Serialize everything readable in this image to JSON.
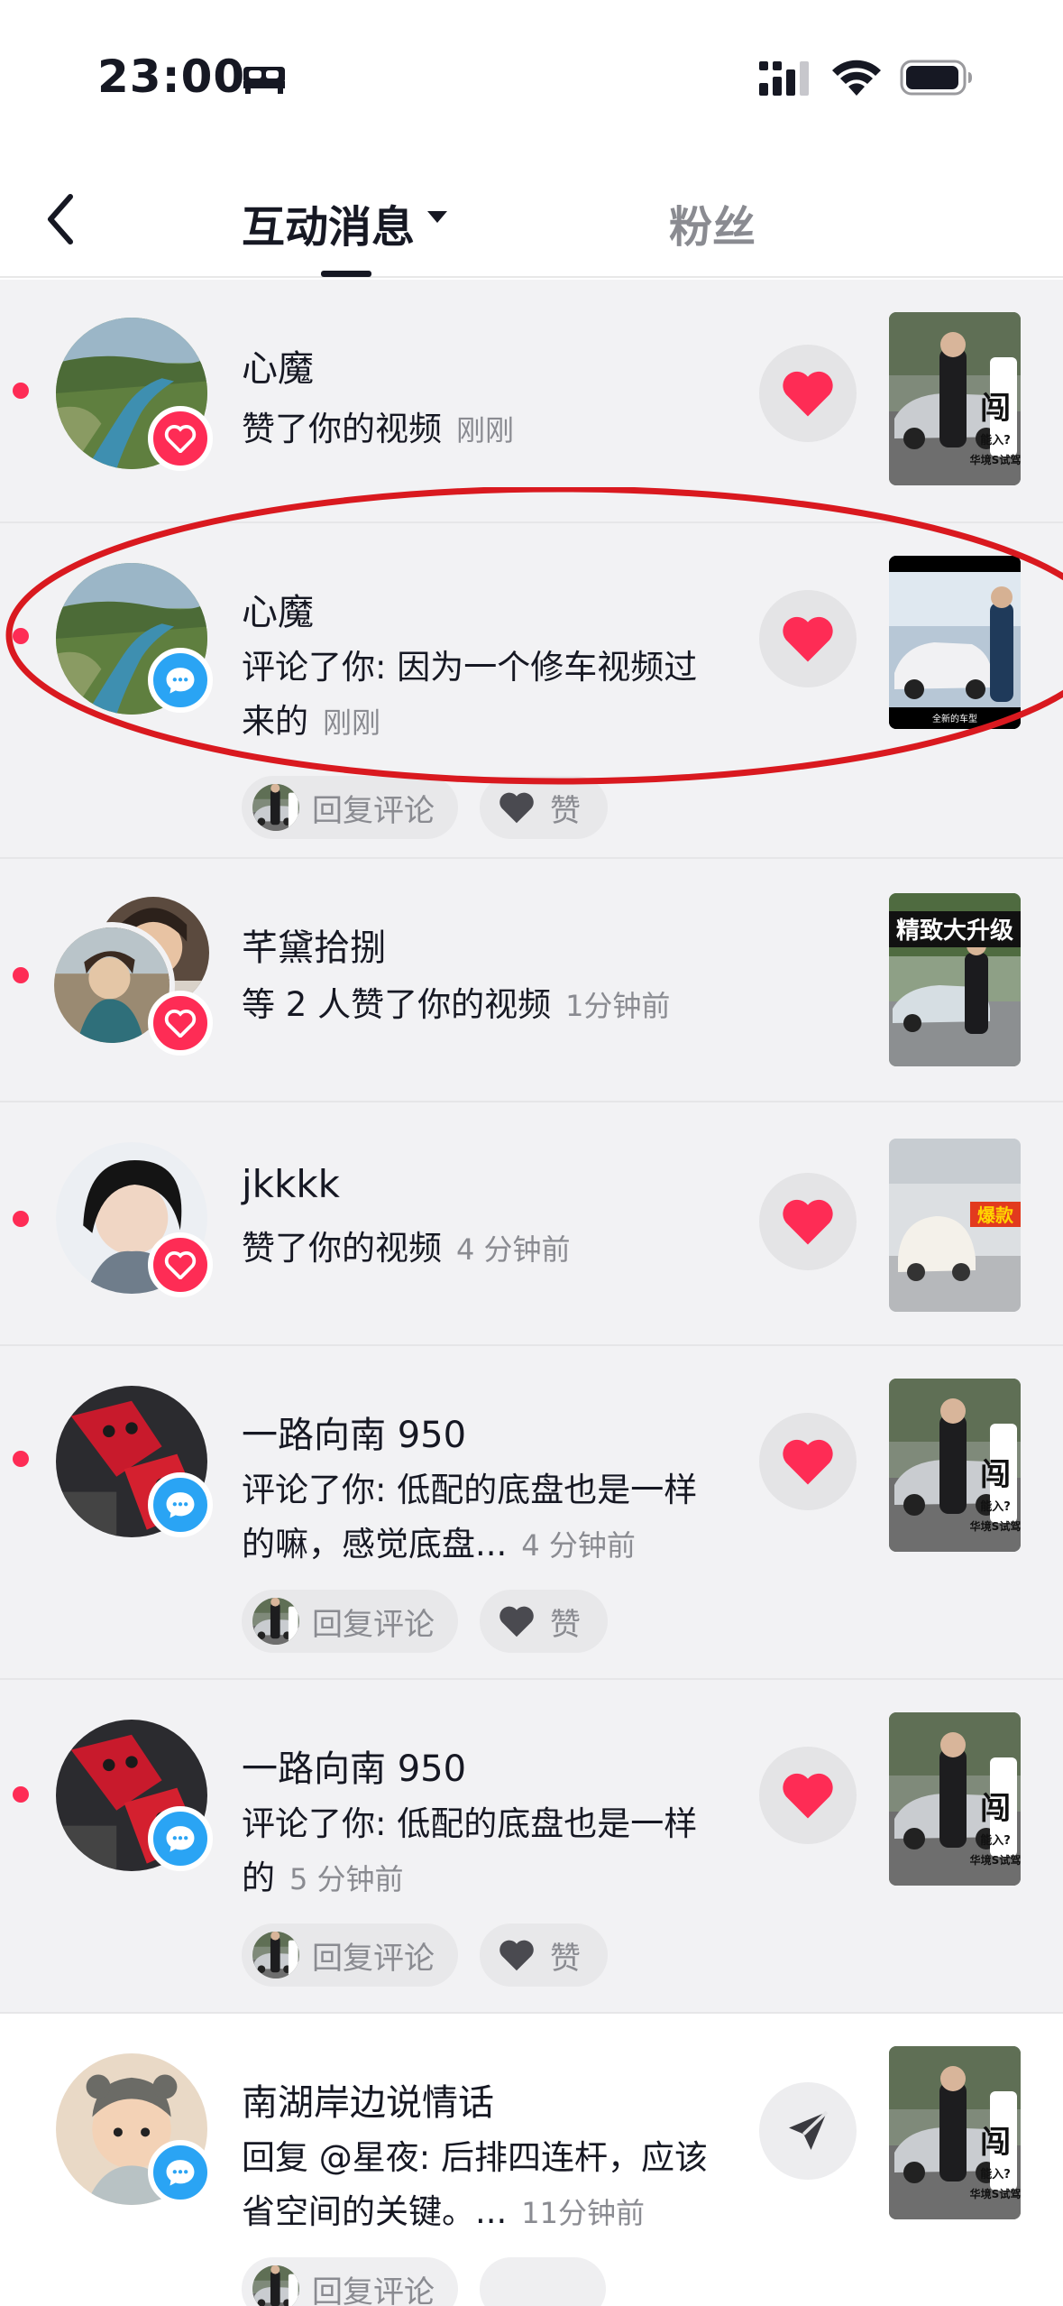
{
  "status_bar": {
    "time": "23:00",
    "icons": [
      "bed-icon",
      "signal-icon",
      "wifi-icon",
      "battery-icon"
    ]
  },
  "header": {
    "back_icon": "chevron-left-icon",
    "tabs": [
      {
        "label": "互动消息",
        "active": true,
        "has_dropdown": true
      },
      {
        "label": "粉丝",
        "active": false
      }
    ]
  },
  "colors": {
    "accent_red": "#fe2c55",
    "comment_blue": "#2aa4f4",
    "unread_bg": "#f2f2f4",
    "annotation_red": "#d9191f"
  },
  "messages": [
    {
      "unread": true,
      "name": "心魔",
      "text": "赞了你的视频",
      "time": "刚刚",
      "badge": "heart-badge-icon",
      "action": "heart-icon",
      "avatar": "landscape-river"
    },
    {
      "unread": true,
      "name": "心魔",
      "text": "评论了你: 因为一个修车视频过来的",
      "time": "刚刚",
      "badge": "comment-badge-icon",
      "action": "heart-icon",
      "avatar": "landscape-river",
      "reply_label": "回复评论",
      "like_label": "赞",
      "thumb_caption": "全新的车型"
    },
    {
      "unread": true,
      "name": "芊黛拾捌",
      "text": "等 2 人赞了你的视频",
      "time": "1分钟前",
      "badge": "heart-badge-icon",
      "action": "",
      "avatar": "stacked-portraits",
      "thumb_caption": "精致大升级"
    },
    {
      "unread": true,
      "name": "jkkkk",
      "text": "赞了你的视频",
      "time": "4 分钟前",
      "badge": "heart-badge-icon",
      "action": "heart-icon",
      "avatar": "portrait",
      "thumb_caption": "爆款"
    },
    {
      "unread": true,
      "name": "一路向南 950",
      "text": "评论了你: 低配的底盘也是一样的嘛，感觉底盘...",
      "time": "4 分钟前",
      "badge": "comment-badge-icon",
      "action": "heart-icon",
      "avatar": "red-pedals",
      "reply_label": "回复评论",
      "like_label": "赞"
    },
    {
      "unread": true,
      "name": "一路向南 950",
      "text": "评论了你: 低配的底盘也是一样的",
      "time": "5 分钟前",
      "badge": "comment-badge-icon",
      "action": "heart-icon",
      "avatar": "red-pedals",
      "reply_label": "回复评论",
      "like_label": "赞"
    },
    {
      "unread": false,
      "name": "南湖岸边说情话",
      "text": "回复 @星夜: 后排四连杆，应该省空间的关键。...",
      "time": "11分钟前",
      "badge": "comment-badge-icon",
      "action": "send-icon",
      "avatar": "baby",
      "reply_label": "回复评论"
    }
  ],
  "thumb_overlay": {
    "big": "闯",
    "line1": "能入?",
    "line2": "华境S试驾"
  }
}
